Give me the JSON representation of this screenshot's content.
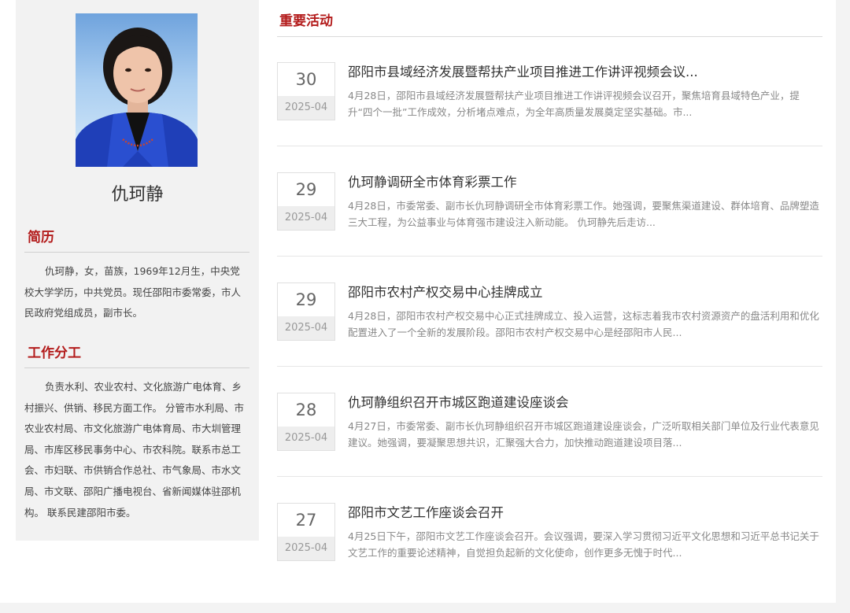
{
  "profile": {
    "name": "仇珂静",
    "bio_title": "简历",
    "bio_text": "仇珂静，女，苗族，1969年12月生，中央党校大学学历，中共党员。现任邵阳市委常委，市人民政府党组成员，副市长。",
    "duty_title": "工作分工",
    "duty_text": "负责水利、农业农村、文化旅游广电体育、乡村振兴、供销、移民方面工作。 分管市水利局、市农业农村局、市文化旅游广电体育局、市大圳管理局、市库区移民事务中心、市农科院。联系市总工会、市妇联、市供销合作总社、市气象局、市水文局、市文联、邵阳广播电视台、省新闻媒体驻邵机构。 联系民建邵阳市委。"
  },
  "activities": {
    "title": "重要活动",
    "items": [
      {
        "day": "30",
        "ym": "2025-04",
        "title": "邵阳市县域经济发展暨帮扶产业项目推进工作讲评视频会议...",
        "summary": "4月28日，邵阳市县域经济发展暨帮扶产业项目推进工作讲评视频会议召开，聚焦培育县域特色产业，提升“四个一批”工作成效，分析堵点难点，为全年高质量发展奠定坚实基础。市..."
      },
      {
        "day": "29",
        "ym": "2025-04",
        "title": "仇珂静调研全市体育彩票工作",
        "summary": "4月28日，市委常委、副市长仇珂静调研全市体育彩票工作。她强调，要聚焦渠道建设、群体培育、品牌塑造三大工程，为公益事业与体育强市建设注入新动能。 仇珂静先后走访..."
      },
      {
        "day": "29",
        "ym": "2025-04",
        "title": "邵阳市农村产权交易中心挂牌成立",
        "summary": "4月28日，邵阳市农村产权交易中心正式挂牌成立、投入运营，这标志着我市农村资源资产的盘活利用和优化配置进入了一个全新的发展阶段。邵阳市农村产权交易中心是经邵阳市人民..."
      },
      {
        "day": "28",
        "ym": "2025-04",
        "title": "仇珂静组织召开市城区跑道建设座谈会",
        "summary": "4月27日，市委常委、副市长仇珂静组织召开市城区跑道建设座谈会，广泛听取相关部门单位及行业代表意见建议。她强调，要凝聚思想共识，汇聚强大合力，加快推动跑道建设项目落..."
      },
      {
        "day": "27",
        "ym": "2025-04",
        "title": "邵阳市文艺工作座谈会召开",
        "summary": "4月25日下午，邵阳市文艺工作座谈会召开。会议强调，要深入学习贯彻习近平文化思想和习近平总书记关于文艺工作的重要论述精神，自觉担负起新的文化使命，创作更多无愧于时代..."
      }
    ]
  }
}
